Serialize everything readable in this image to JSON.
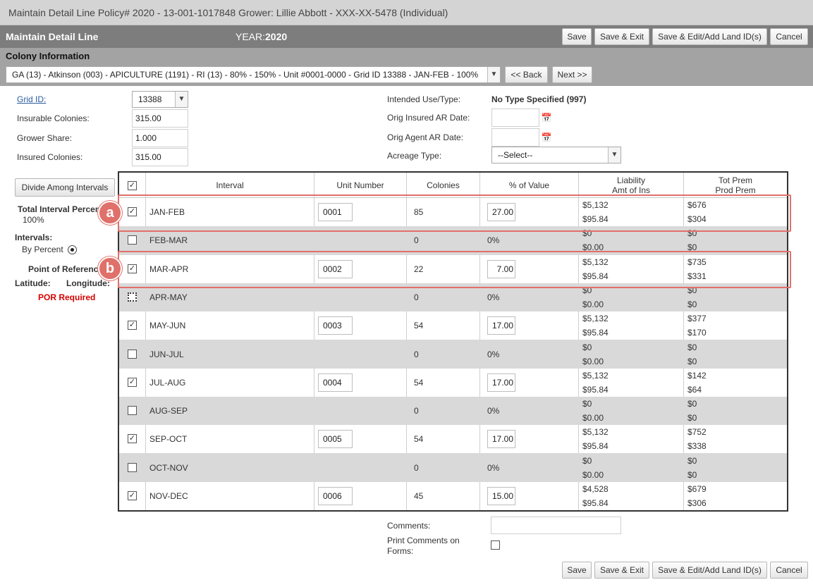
{
  "window": {
    "title": "Maintain Detail Line Policy# 2020 - 13-001-1017848 Grower: Lillie Abbott - XXX-XX-5478 (Individual)"
  },
  "header": {
    "title": "Maintain Detail Line",
    "year_label": "YEAR:",
    "year_value": "2020",
    "buttons": {
      "save": "Save",
      "save_exit": "Save & Exit",
      "save_edit": "Save & Edit/Add Land ID(s)",
      "cancel": "Cancel"
    }
  },
  "colony": {
    "title": "Colony Information",
    "selected": "GA (13) - Atkinson (003) - APICULTURE (1191) - RI (13) - 80% - 150% - Unit #0001-0000 - Grid ID 13388 - JAN-FEB - 100%",
    "back": "<< Back",
    "next": "Next >>"
  },
  "form": {
    "grid_id_label": "Grid ID:",
    "grid_id_value": "13388",
    "insurable_label": "Insurable Colonies:",
    "insurable_value": "315.00",
    "share_label": "Grower Share:",
    "share_value": "1.000",
    "insured_label": "Insured Colonies:",
    "insured_value": "315.00",
    "intended_label": "Intended Use/Type:",
    "intended_value": "No Type Specified (997)",
    "orig_insured_label": "Orig Insured AR Date:",
    "orig_agent_label": "Orig Agent AR Date:",
    "acreage_label": "Acreage Type:",
    "acreage_value": "--Select--"
  },
  "left": {
    "divide_button": "Divide Among Intervals",
    "total_label": "Total Interval Percent",
    "total_value": "100%",
    "intervals_label": "Intervals:",
    "by_percent": "By Percent",
    "point_ref": "Point of Reference",
    "latitude": "Latitude:",
    "longitude": "Longitude:",
    "por_required": "POR Required"
  },
  "table": {
    "headers": {
      "interval": "Interval",
      "unit": "Unit Number",
      "colonies": "Colonies",
      "pct": "% of Value",
      "liab1": "Liability",
      "liab2": "Amt of Ins",
      "prem1": "Tot Prem",
      "prem2": "Prod Prem"
    },
    "rows": [
      {
        "interval": "JAN-FEB",
        "checked": true,
        "unit": "0001",
        "colonies": "85",
        "pct": "27.00",
        "liab": "$5,132",
        "amt": "$95.84",
        "tot": "$676",
        "prod": "$304"
      },
      {
        "interval": "FEB-MAR",
        "checked": false,
        "unit": "",
        "colonies": "0",
        "pct": "0%",
        "liab": "$0",
        "amt": "$0.00",
        "tot": "$0",
        "prod": "$0"
      },
      {
        "interval": "MAR-APR",
        "checked": true,
        "unit": "0002",
        "colonies": "22",
        "pct": "7.00",
        "liab": "$5,132",
        "amt": "$95.84",
        "tot": "$735",
        "prod": "$331"
      },
      {
        "interval": "APR-MAY",
        "checked": false,
        "unit": "",
        "colonies": "0",
        "pct": "0%",
        "liab": "$0",
        "amt": "$0.00",
        "tot": "$0",
        "prod": "$0"
      },
      {
        "interval": "MAY-JUN",
        "checked": true,
        "unit": "0003",
        "colonies": "54",
        "pct": "17.00",
        "liab": "$5,132",
        "amt": "$95.84",
        "tot": "$377",
        "prod": "$170"
      },
      {
        "interval": "JUN-JUL",
        "checked": false,
        "unit": "",
        "colonies": "0",
        "pct": "0%",
        "liab": "$0",
        "amt": "$0.00",
        "tot": "$0",
        "prod": "$0"
      },
      {
        "interval": "JUL-AUG",
        "checked": true,
        "unit": "0004",
        "colonies": "54",
        "pct": "17.00",
        "liab": "$5,132",
        "amt": "$95.84",
        "tot": "$142",
        "prod": "$64"
      },
      {
        "interval": "AUG-SEP",
        "checked": false,
        "unit": "",
        "colonies": "0",
        "pct": "0%",
        "liab": "$0",
        "amt": "$0.00",
        "tot": "$0",
        "prod": "$0"
      },
      {
        "interval": "SEP-OCT",
        "checked": true,
        "unit": "0005",
        "colonies": "54",
        "pct": "17.00",
        "liab": "$5,132",
        "amt": "$95.84",
        "tot": "$752",
        "prod": "$338"
      },
      {
        "interval": "OCT-NOV",
        "checked": false,
        "unit": "",
        "colonies": "0",
        "pct": "0%",
        "liab": "$0",
        "amt": "$0.00",
        "tot": "$0",
        "prod": "$0"
      },
      {
        "interval": "NOV-DEC",
        "checked": true,
        "unit": "0006",
        "colonies": "45",
        "pct": "15.00",
        "liab": "$4,528",
        "amt": "$95.84",
        "tot": "$679",
        "prod": "$306"
      }
    ]
  },
  "comments": {
    "label": "Comments:",
    "print_label_1": "Print Comments on",
    "print_label_2": "Forms:"
  },
  "callouts": {
    "a": "a",
    "b": "b"
  }
}
